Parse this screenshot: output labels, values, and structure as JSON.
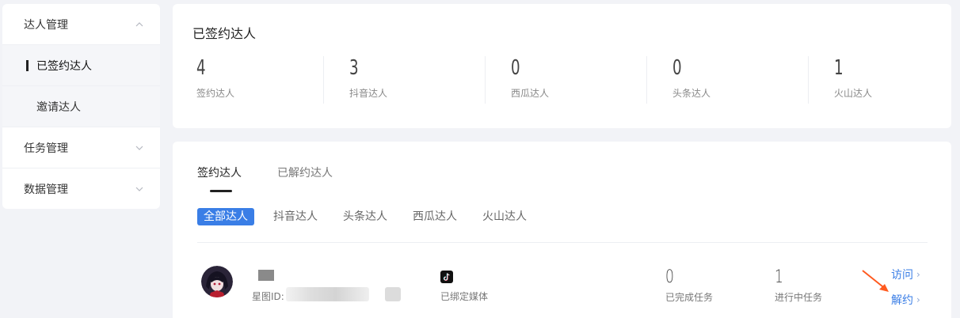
{
  "sidebar": {
    "groups": [
      {
        "label": "达人管理",
        "expanded": true
      },
      {
        "label": "任务管理",
        "expanded": false
      },
      {
        "label": "数据管理",
        "expanded": false
      }
    ],
    "subitems": [
      {
        "label": "已签约达人",
        "active": true
      },
      {
        "label": "邀请达人",
        "active": false
      }
    ]
  },
  "stats": {
    "title": "已签约达人",
    "items": [
      {
        "value": "4",
        "label": "签约达人"
      },
      {
        "value": "3",
        "label": "抖音达人"
      },
      {
        "value": "0",
        "label": "西瓜达人"
      },
      {
        "value": "0",
        "label": "头条达人"
      },
      {
        "value": "1",
        "label": "火山达人"
      }
    ]
  },
  "list": {
    "tabs": [
      {
        "label": "签约达人",
        "active": true
      },
      {
        "label": "已解约达人",
        "active": false
      }
    ],
    "filters": [
      {
        "label": "全部达人",
        "active": true
      },
      {
        "label": "抖音达人",
        "active": false
      },
      {
        "label": "头条达人",
        "active": false
      },
      {
        "label": "西瓜达人",
        "active": false
      },
      {
        "label": "火山达人",
        "active": false
      }
    ],
    "row": {
      "xingtu_label": "星图ID:",
      "media_label": "已绑定媒体",
      "completed_value": "0",
      "completed_label": "已完成任务",
      "inprogress_value": "1",
      "inprogress_label": "进行中任务",
      "visit_label": "访问",
      "terminate_label": "解约"
    }
  },
  "colors": {
    "accent": "#3a7ee6",
    "pointer": "#ff5a1f",
    "background": "#f2f3f7"
  }
}
